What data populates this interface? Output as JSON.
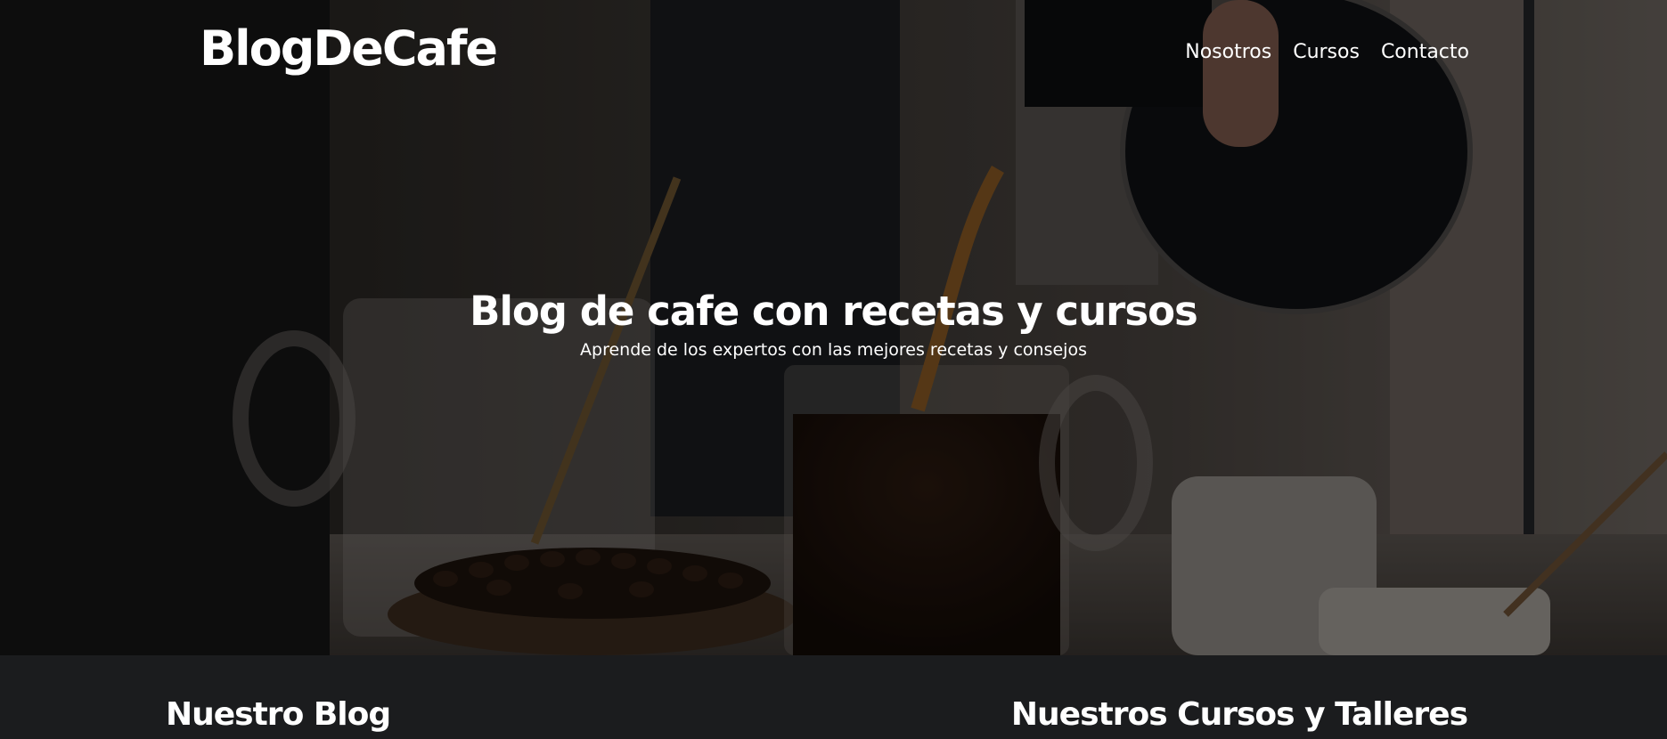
{
  "header": {
    "logo": "BlogDeCafe",
    "nav": [
      {
        "label": "Nosotros"
      },
      {
        "label": "Cursos"
      },
      {
        "label": "Contacto"
      }
    ]
  },
  "hero": {
    "title": "Blog de cafe con recetas y cursos",
    "subtitle": "Aprende de los expertos con las mejores recetas y consejos"
  },
  "sections": {
    "blog_title": "Nuestro Blog",
    "courses_title": "Nuestros Cursos y Talleres"
  },
  "colors": {
    "footer_bg": "#1b1c1e",
    "text": "#ffffff"
  }
}
